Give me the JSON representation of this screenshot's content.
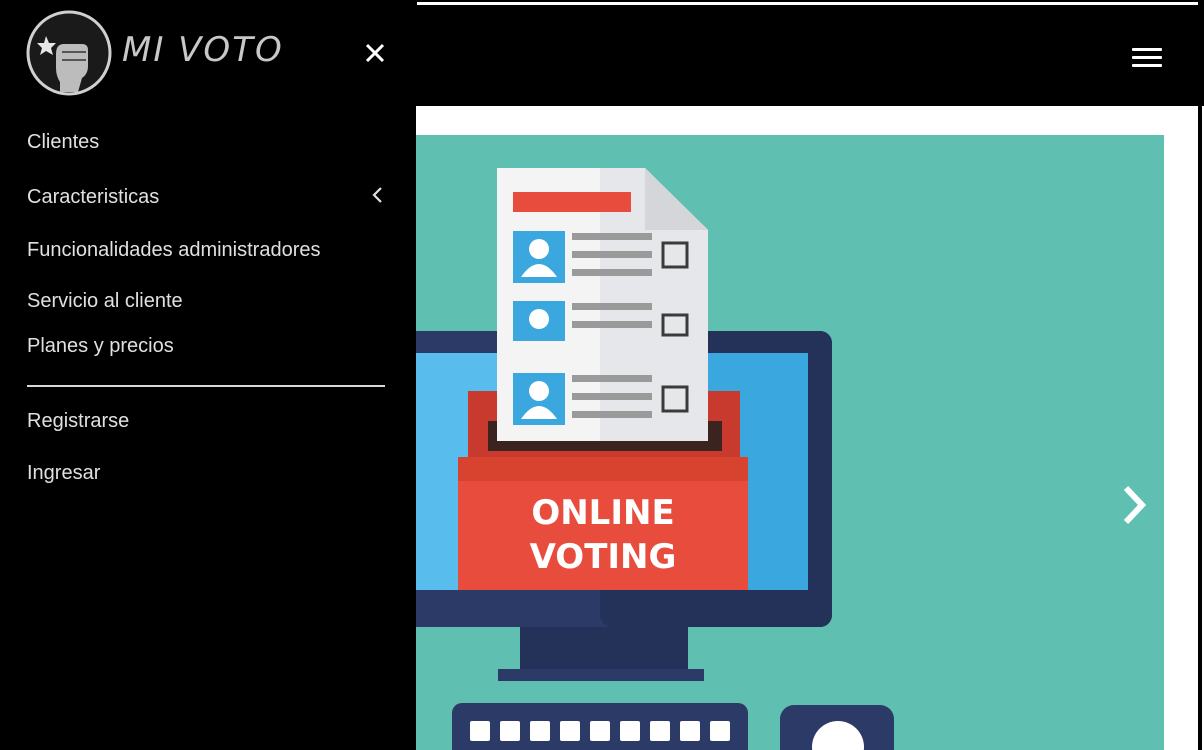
{
  "brand": {
    "name": "MI VOTO",
    "logo_icon": "raised-fist-star-icon"
  },
  "drawer": {
    "close_icon": "close-icon",
    "menu": [
      {
        "label": "Clientes"
      },
      {
        "label": "Caracteristicas",
        "has_submenu": true,
        "icon": "chevron-left-icon"
      },
      {
        "label": "Funcionalidades administradores"
      },
      {
        "label": "Servicio al cliente"
      },
      {
        "label": "Planes y precios"
      }
    ],
    "account": [
      {
        "label": "Registrarse"
      },
      {
        "label": "Ingresar"
      }
    ]
  },
  "header": {
    "menu_icon": "hamburger-icon"
  },
  "hero": {
    "caption_line1": "ONLINE",
    "caption_line2": "VOTING",
    "next_icon": "chevron-right-icon"
  },
  "colors": {
    "drawer_bg": "#000000",
    "hero_bg": "#5fbfb1",
    "ballot_box": "#e84c3d",
    "monitor": "#2c3e6b",
    "screen": "#3aa3dc"
  }
}
